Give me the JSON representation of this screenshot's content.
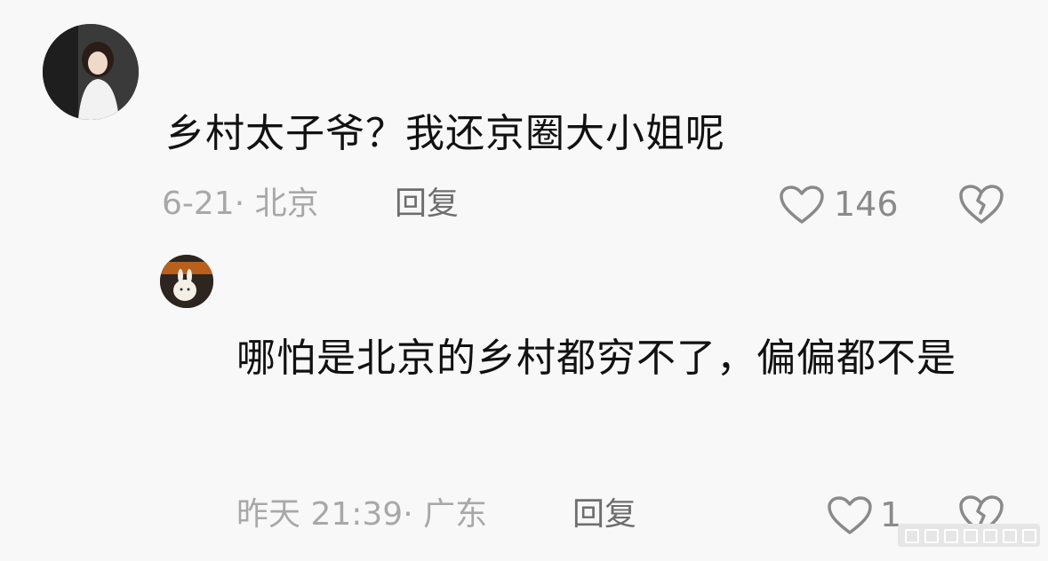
{
  "comments": [
    {
      "text": "乡村太子爷？我还京圈大小姐呢",
      "meta": "6-21· 北京",
      "reply": "回复",
      "likes": "146"
    },
    {
      "text": "哪怕是北京的乡村都穷不了，偏偏都不是",
      "meta": "昨天 21:39· 广东",
      "reply": "回复",
      "likes": "1"
    }
  ],
  "icons": {
    "like": "heart-outline-icon",
    "dislike": "broken-heart-icon"
  },
  "colors": {
    "background": "#f8f8f8",
    "text": "#111111",
    "meta": "#a8a8a8",
    "icon": "#8a8a8a"
  }
}
